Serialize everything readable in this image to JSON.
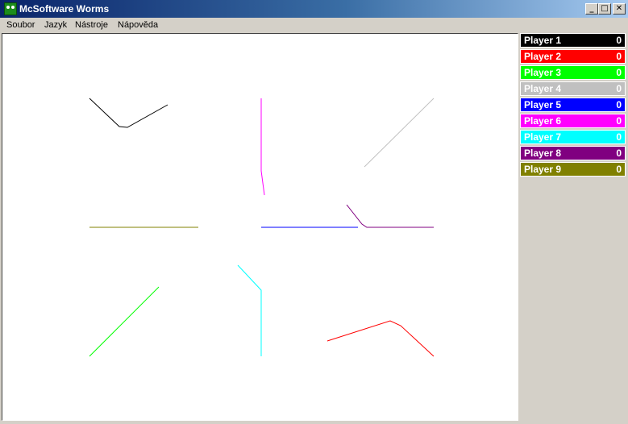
{
  "window": {
    "title": "McSoftware Worms",
    "controls": {
      "minimize": "_",
      "maximize": "□",
      "close": "✕"
    }
  },
  "menu": [
    "Soubor",
    "Jazyk",
    "Nástroje",
    "Nápověda"
  ],
  "players": [
    {
      "name": "Player 1",
      "score": "0",
      "color": "#000000",
      "text_color": "#ffffff"
    },
    {
      "name": "Player 2",
      "score": "0",
      "color": "#ff0000",
      "text_color": "#ffffff"
    },
    {
      "name": "Player 3",
      "score": "0",
      "color": "#00ff00",
      "text_color": "#ffffff"
    },
    {
      "name": "Player 4",
      "score": "0",
      "color": "#c0c0c0",
      "text_color": "#ffffff"
    },
    {
      "name": "Player 5",
      "score": "0",
      "color": "#0000ff",
      "text_color": "#ffffff"
    },
    {
      "name": "Player 6",
      "score": "0",
      "color": "#ff00ff",
      "text_color": "#ffffff"
    },
    {
      "name": "Player 7",
      "score": "0",
      "color": "#00ffff",
      "text_color": "#ffffff"
    },
    {
      "name": "Player 8",
      "score": "0",
      "color": "#800080",
      "text_color": "#ffffff"
    },
    {
      "name": "Player 9",
      "score": "0",
      "color": "#808000",
      "text_color": "#ffffff"
    }
  ]
}
